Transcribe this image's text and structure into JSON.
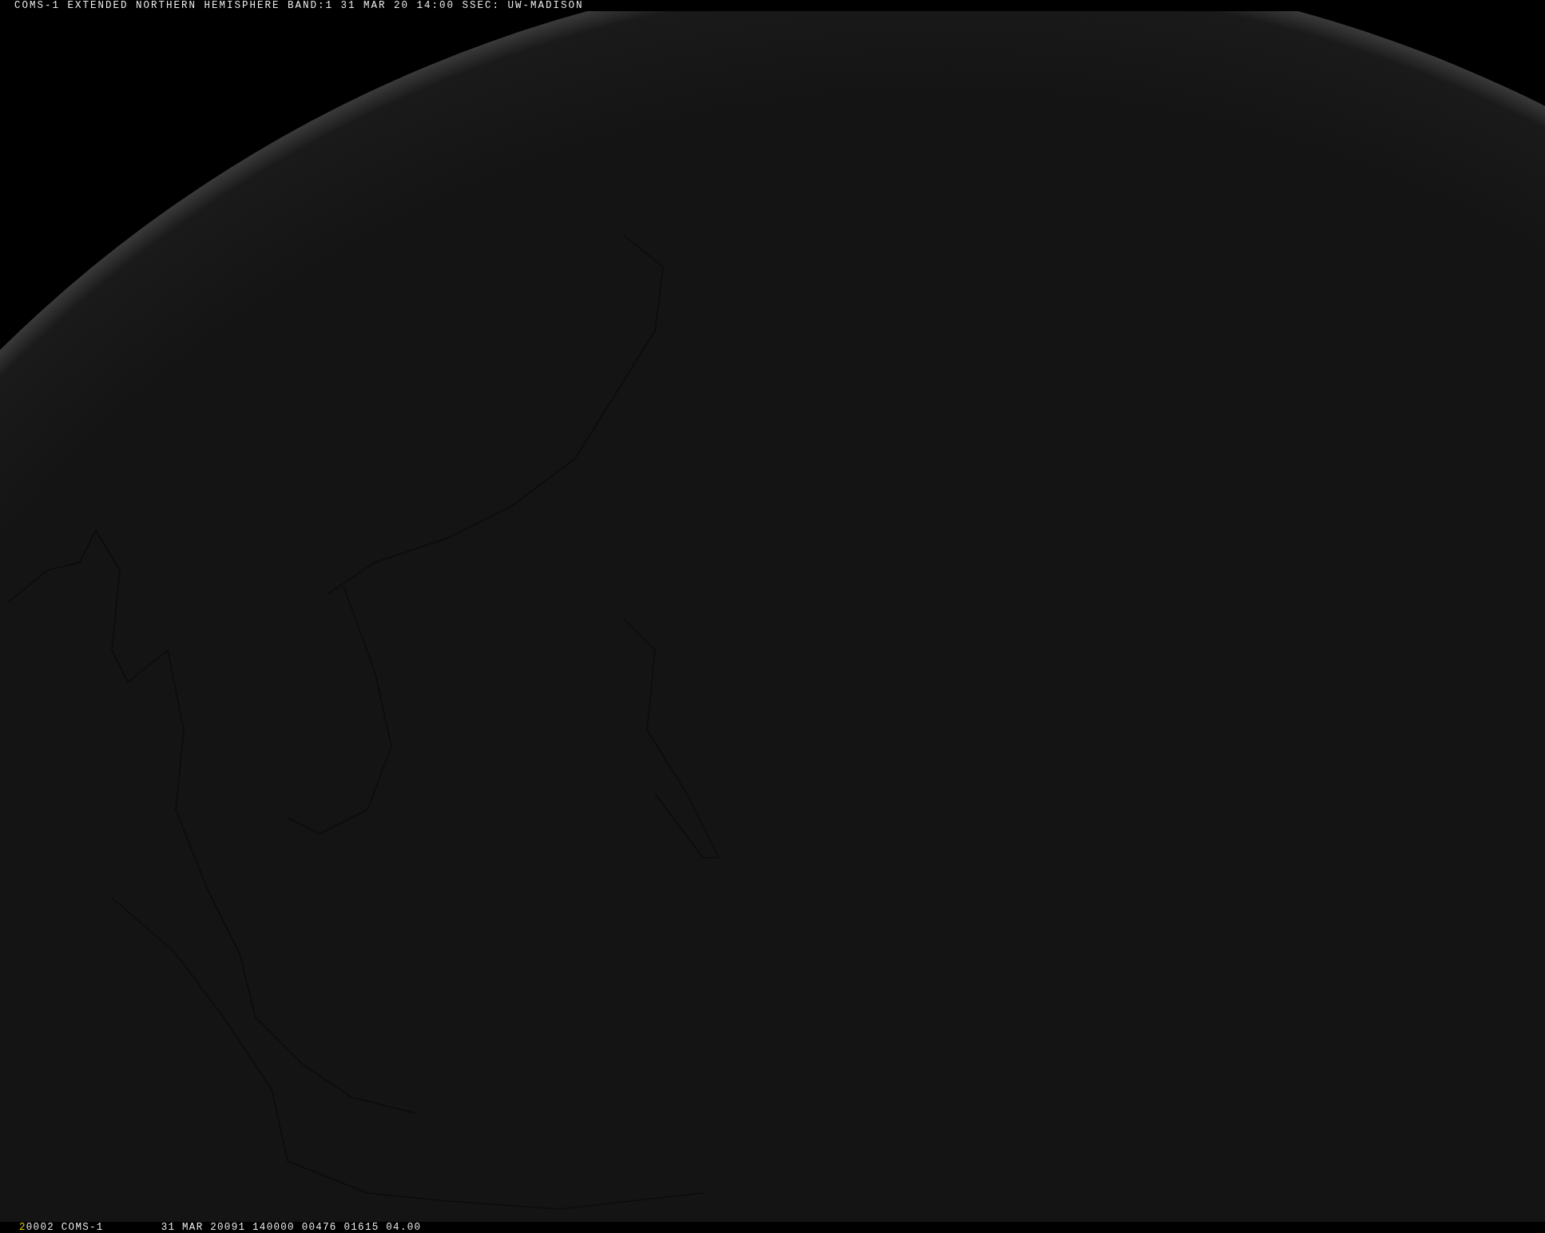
{
  "header": {
    "title": "COMS-1 EXTENDED NORTHERN HEMISPHERE BAND:1 31 MAR 20 14:00 SSEC: UW-MADISON"
  },
  "footer": {
    "frame_number": "2",
    "fields": [
      "0002 COMS-1",
      "31 MAR 20091 140000 00476 01615 04.00"
    ]
  }
}
